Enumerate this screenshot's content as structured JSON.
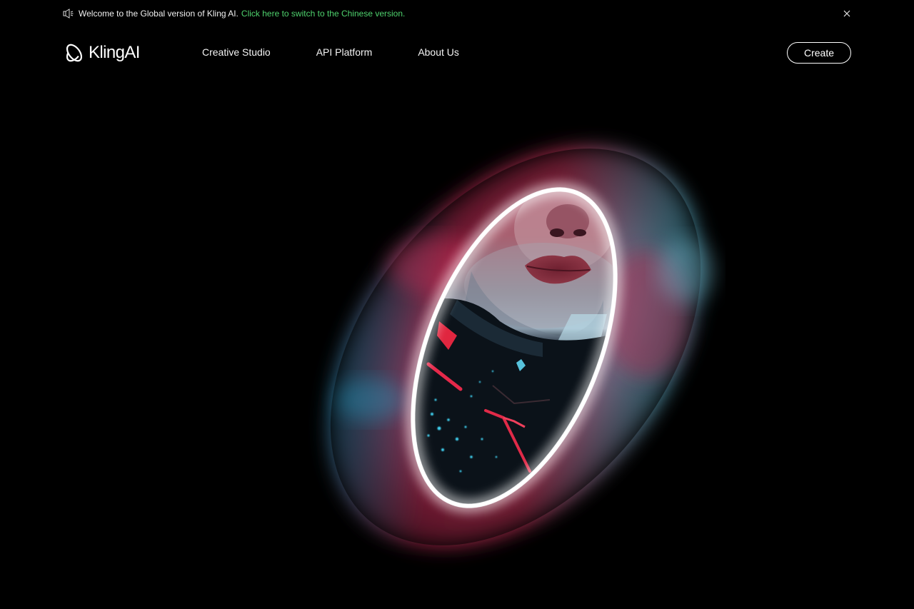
{
  "announcement": {
    "icon": "speaker-icon",
    "welcome_text": "Welcome to the Global version of Kling AI.",
    "link_text": "Click here to switch to the Chinese version.",
    "link_color": "#4fd36e",
    "close_icon": "close-icon"
  },
  "header": {
    "logo_text": "KlingAI",
    "nav": [
      {
        "label": "Creative Studio"
      },
      {
        "label": "API Platform"
      },
      {
        "label": "About Us"
      }
    ],
    "create_label": "Create"
  },
  "hero": {
    "colors": {
      "background": "#000000",
      "magenta": "#d2315d",
      "cyan": "#2aa8c9",
      "ring": "#ffffff"
    }
  }
}
